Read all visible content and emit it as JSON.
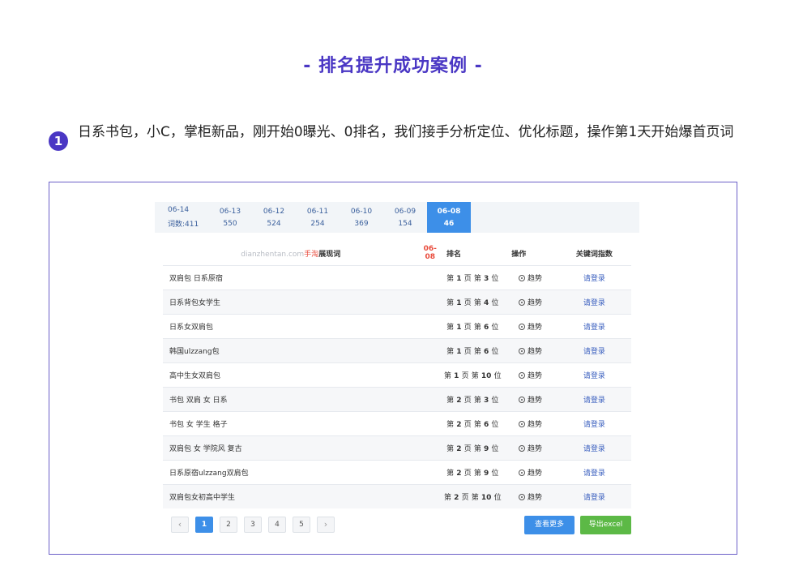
{
  "header": {
    "title": "- 排名提升成功案例 -"
  },
  "step": {
    "number": "1",
    "text": "日系书包，小C，掌柜新品，刚开始0曝光、0排名，我们接手分析定位、优化标题，操作第1天开始爆首页词"
  },
  "tabs": [
    {
      "date": "06-14",
      "count": "词数:411"
    },
    {
      "date": "06-13",
      "count": "550"
    },
    {
      "date": "06-12",
      "count": "524"
    },
    {
      "date": "06-11",
      "count": "254"
    },
    {
      "date": "06-10",
      "count": "369"
    },
    {
      "date": "06-09",
      "count": "154"
    },
    {
      "date": "06-08",
      "count": "46"
    }
  ],
  "table": {
    "header": {
      "source_site": "dianzhentan.com",
      "source_app": "手淘",
      "source_label": "展现词",
      "date": "06-08",
      "rank": "排名",
      "operation": "操作",
      "index": "关键词指数"
    },
    "rows": [
      {
        "keyword": "双肩包 日系原宿",
        "page": "1",
        "pos": "3"
      },
      {
        "keyword": "日系背包女学生",
        "page": "1",
        "pos": "4"
      },
      {
        "keyword": "日系女双肩包",
        "page": "1",
        "pos": "6"
      },
      {
        "keyword": "韩国ulzzang包",
        "page": "1",
        "pos": "6"
      },
      {
        "keyword": "高中生女双肩包",
        "page": "1",
        "pos": "10"
      },
      {
        "keyword": "书包 双肩 女 日系",
        "page": "2",
        "pos": "3"
      },
      {
        "keyword": "书包 女 学生 格子",
        "page": "2",
        "pos": "6"
      },
      {
        "keyword": "双肩包 女 学院风 复古",
        "page": "2",
        "pos": "9"
      },
      {
        "keyword": "日系原宿ulzzang双肩包",
        "page": "2",
        "pos": "9"
      },
      {
        "keyword": "双肩包女初高中学生",
        "page": "2",
        "pos": "10"
      }
    ],
    "rank_prefix": "第",
    "page_unit": "页",
    "pos_prefix": "第",
    "pos_unit": "位",
    "trend_label": "趋势",
    "login_label": "请登录"
  },
  "pagination": {
    "prev": "‹",
    "pages": [
      "1",
      "2",
      "3",
      "4",
      "5"
    ],
    "active": "1",
    "next": "›"
  },
  "buttons": {
    "more": "查看更多",
    "excel": "导出excel"
  },
  "colors": {
    "accent": "#4a37c4",
    "primary": "#3d8fe8",
    "export": "#5cb946",
    "highlight": "#e94b3c"
  }
}
